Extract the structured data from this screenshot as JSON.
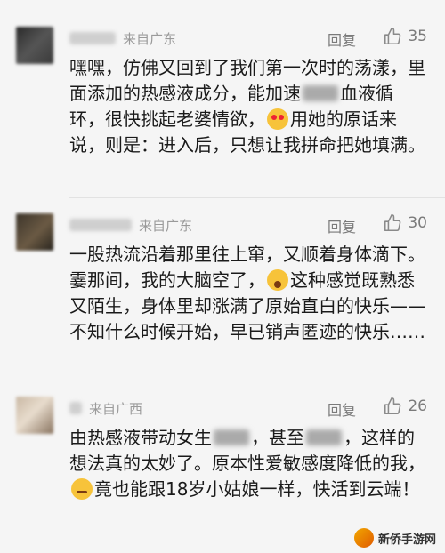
{
  "comments": [
    {
      "source": "来自广东",
      "reply": "回复",
      "likes": "35",
      "text_1": "嘿嘿，仿佛又回到了我们第一次时的荡漾，里面添加的热感液成分，能加速",
      "text_2": "血液循环，很快挑起老婆情欲，",
      "text_3": "用她的原话来说，则是：进入后，只想让我拼命把她填满。"
    },
    {
      "source": "来自广东",
      "reply": "回复",
      "likes": "30",
      "text_1": "一股热流沿着那里往上窜，又顺着身体滴下。霎那间，我的大脑空了，",
      "text_2": "这种感觉既熟悉又陌生，身体里却涨满了原始直白的快乐——不知什么时候开始，早已销声匿迹的快乐……"
    },
    {
      "source": "来自广西",
      "reply": "回复",
      "likes": "26",
      "text_1": "由热感液带动女生",
      "text_2": "，甚至",
      "text_3": "，这样的想法真的太妙了。原本性爱敏感度降低的我，",
      "text_4": "竟也能跟18岁小姑娘一样，快活到云端！"
    }
  ],
  "watermark": "新侨手游网"
}
